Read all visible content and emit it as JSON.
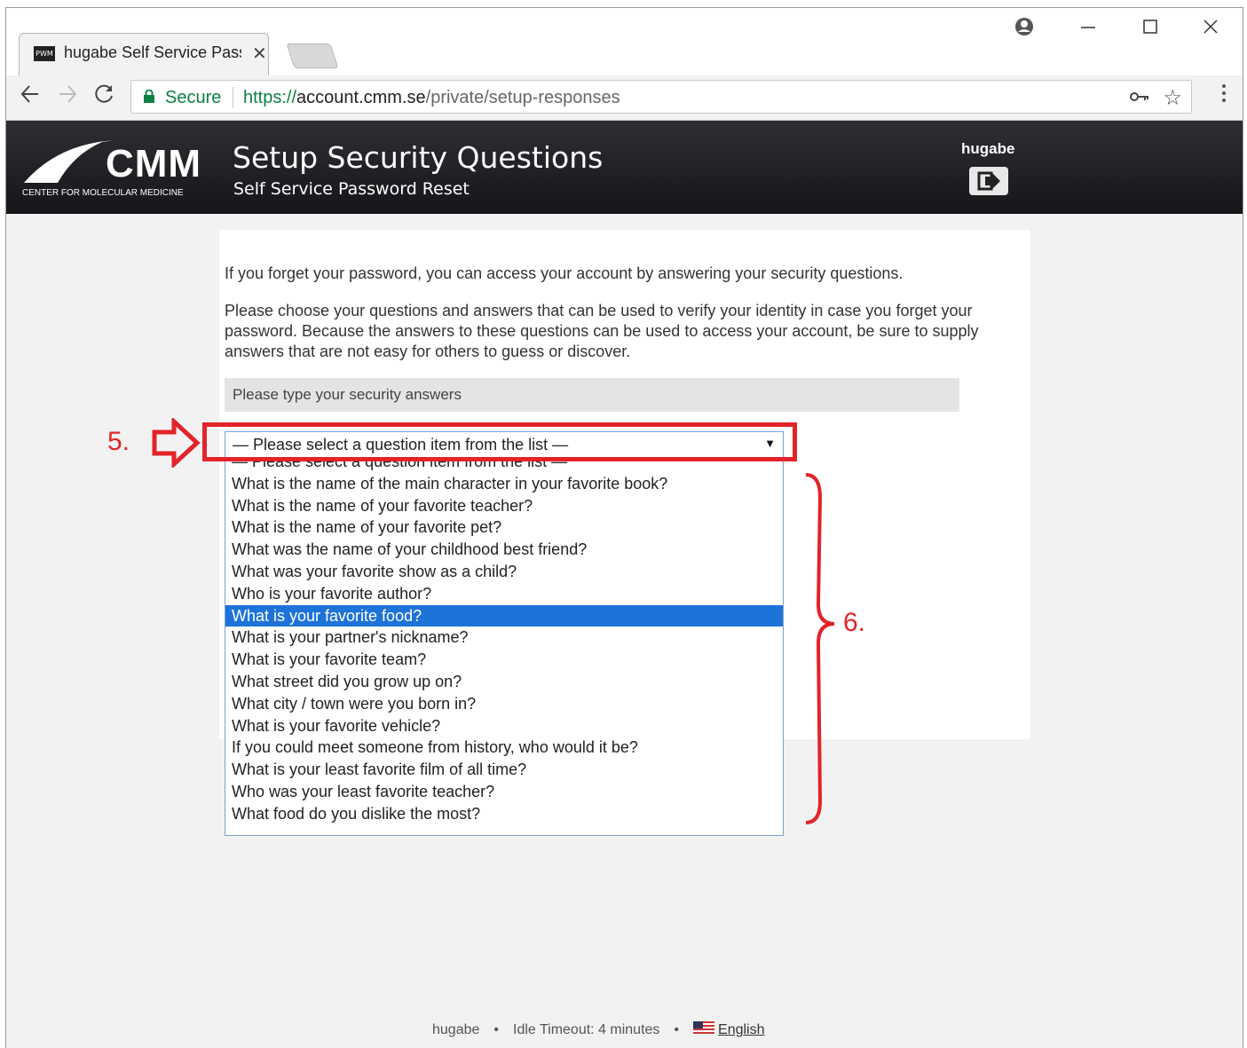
{
  "browser": {
    "tab_title": "hugabe Self Service Pass",
    "favicon_text": "PWM",
    "security_label": "Secure",
    "url_protocol": "https://",
    "url_host": "account.cmm.se",
    "url_path": "/private/setup-responses"
  },
  "header": {
    "logo_text": "CMM",
    "logo_subtitle": "CENTER FOR MOLECULAR MEDICINE",
    "title": "Setup Security Questions",
    "subtitle": "Self Service Password Reset",
    "username": "hugabe"
  },
  "content": {
    "intro": "If you forget your password, you can access your account by answering your security questions.",
    "instruction": "Please choose your questions and answers that can be used to verify your identity in case you forget your password. Because the answers to these questions can be used to access your account, be sure to supply answers that are not easy for others to guess or discover.",
    "section_label": "Please type your security answers",
    "select_value": "— Please select a question item from the list —",
    "options": [
      "— Please select a question item from the list —",
      "What is the name of the main character in your favorite book?",
      "What is the name of your favorite teacher?",
      "What is the name of your favorite pet?",
      "What was the name of your childhood best friend?",
      "What was your favorite show as a child?",
      "Who is your favorite author?",
      "What is your favorite food?",
      "What is your partner's nickname?",
      "What is your favorite team?",
      "What street did you grow up on?",
      "What city / town were you born in?",
      "What is your favorite vehicle?",
      "If you could meet someone from history, who would it be?",
      "What is your least favorite film of all time?",
      "Who was your least favorite teacher?",
      "What food do you dislike the most?"
    ],
    "highlighted_option_index": 7
  },
  "annotations": {
    "step5": "5.",
    "step6": "6.",
    "color": "#e2242a"
  },
  "footer": {
    "username": "hugabe",
    "idle_timeout": "Idle Timeout: 4 minutes",
    "language": "English"
  }
}
